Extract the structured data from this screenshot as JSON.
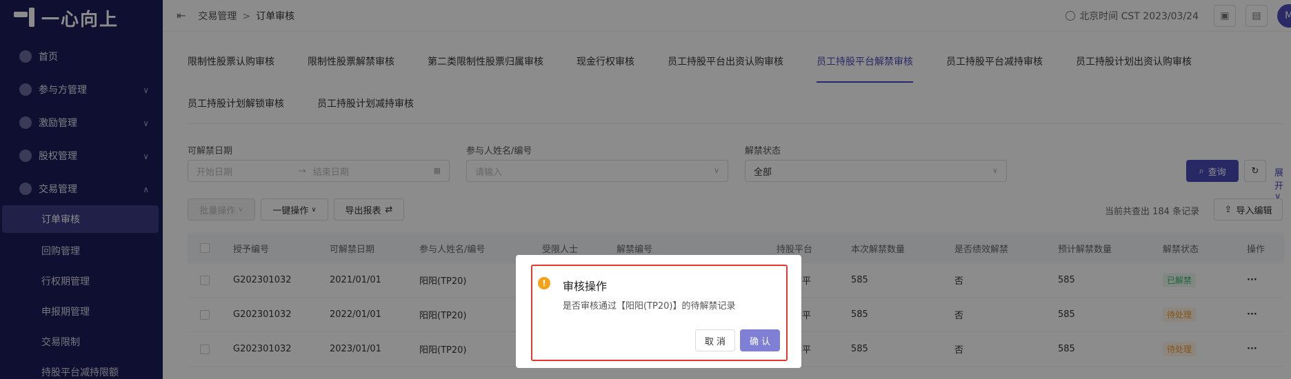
{
  "app": {
    "logo_text": "一心向上"
  },
  "sidebar": {
    "items": [
      {
        "label": "首页"
      },
      {
        "label": "参与方管理"
      },
      {
        "label": "激励管理"
      },
      {
        "label": "股权管理"
      },
      {
        "label": "交易管理"
      }
    ],
    "sub_items": [
      {
        "label": "订单审核",
        "active": true
      },
      {
        "label": "回购管理"
      },
      {
        "label": "行权期管理"
      },
      {
        "label": "申报期管理"
      },
      {
        "label": "交易限制"
      },
      {
        "label": "持股平台减持限额"
      }
    ]
  },
  "topbar": {
    "breadcrumb": [
      "交易管理",
      "订单审核"
    ],
    "clock_text": "北京时间 CST 2023/03/24",
    "avatar_initial": "M"
  },
  "tabs": {
    "row1": [
      "限制性股票认购审核",
      "限制性股票解禁审核",
      "第二类限制性股票归属审核",
      "现金行权审核",
      "员工持股平台出资认购审核",
      "员工持股平台解禁审核",
      "员工持股平台减持审核",
      "员工持股计划出资认购审核"
    ],
    "row2": [
      "员工持股计划解锁审核",
      "员工持股计划减持审核"
    ],
    "active": "员工持股平台解禁审核"
  },
  "filters": {
    "date_label": "可解禁日期",
    "date_start_placeholder": "开始日期",
    "date_end_placeholder": "结束日期",
    "participant_label": "参与人姓名/编号",
    "participant_placeholder": "请输入",
    "status_label": "解禁状态",
    "status_value": "全部",
    "search_button": "查询",
    "expand_link": "展开"
  },
  "toolbar": {
    "batch_button": "批量操作",
    "oneclick_button": "一键操作",
    "export_button": "导出报表",
    "record_count_text": "当前共查出 184 条记录",
    "import_button": "导入编辑"
  },
  "table": {
    "headers": [
      "授予编号",
      "可解禁日期",
      "参与人姓名/编号",
      "受限人士",
      "解禁编号",
      "持股平台",
      "本次解禁数量",
      "是否绩效解禁",
      "预计解禁数量",
      "解禁状态",
      "操作"
    ],
    "rows": [
      {
        "grant_no": "G202301032",
        "date": "2021/01/01",
        "participant": "阳阳(TP20)",
        "platform": "世平",
        "qty": "585",
        "perf": "否",
        "est_qty": "585",
        "status": "已解禁",
        "status_type": "ok"
      },
      {
        "grant_no": "G202301032",
        "date": "2022/01/01",
        "participant": "阳阳(TP20)",
        "platform": "世平",
        "qty": "585",
        "perf": "否",
        "est_qty": "585",
        "status": "待处理",
        "status_type": "pend"
      },
      {
        "grant_no": "G202301032",
        "date": "2023/01/01",
        "participant": "阳阳(TP20)",
        "platform": "世平",
        "qty": "585",
        "perf": "否",
        "est_qty": "585",
        "status": "待处理",
        "status_type": "pend"
      }
    ]
  },
  "dialog": {
    "title": "审核操作",
    "body": "是否审核通过【阳阳(TP20)】的待解禁记录",
    "cancel_label": "取 消",
    "confirm_label": "确 认"
  }
}
